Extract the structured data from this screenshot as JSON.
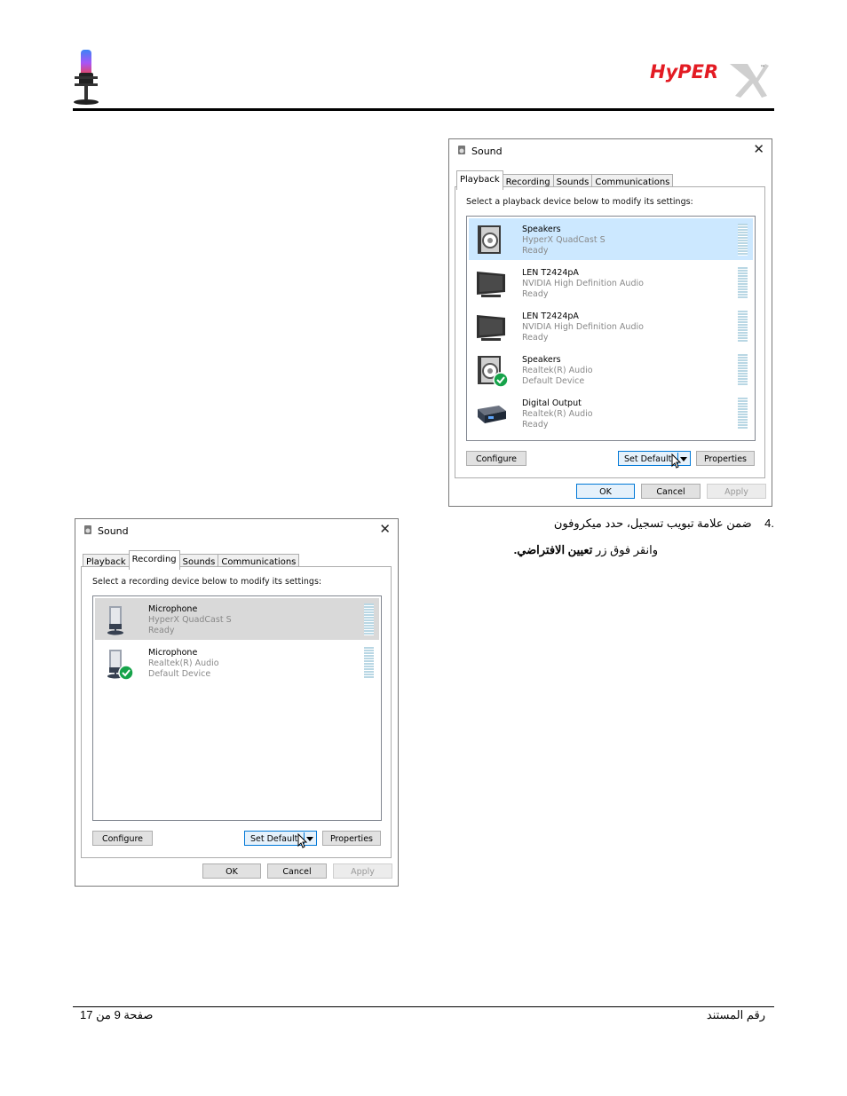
{
  "header": {
    "brand": "HyPER",
    "brand_tm": "™"
  },
  "step4": {
    "number": ".4",
    "line1": "ضمن علامة تبويب تسجيل، حدد ميكروفون",
    "line2_prefix": "وانقر فوق زر ",
    "line2_bold": "تعيين الافتراضي",
    "line2_suffix": "."
  },
  "footer": {
    "page": "صفحة 9 من 17",
    "doc_number": "رقم المستند"
  },
  "playback_dialog": {
    "title": "Sound",
    "close": "✕",
    "tabs": [
      "Playback",
      "Recording",
      "Sounds",
      "Communications"
    ],
    "active_tab": "Playback",
    "instruction": "Select a playback device below to modify its settings:",
    "devices": [
      {
        "name": "Speakers",
        "driver": "HyperX QuadCast S",
        "status": "Ready",
        "icon": "speaker-icon"
      },
      {
        "name": "LEN T2424pA",
        "driver": "NVIDIA High Definition Audio",
        "status": "Ready",
        "icon": "monitor-icon"
      },
      {
        "name": "LEN T2424pA",
        "driver": "NVIDIA High Definition Audio",
        "status": "Ready",
        "icon": "monitor-icon"
      },
      {
        "name": "Speakers",
        "driver": "Realtek(R) Audio",
        "status": "Default Device",
        "icon": "speaker-default-icon"
      },
      {
        "name": "Digital Output",
        "driver": "Realtek(R) Audio",
        "status": "Ready",
        "icon": "digital-output-icon"
      }
    ],
    "configure": "Configure",
    "set_default": "Set Default",
    "properties": "Properties",
    "ok": "OK",
    "cancel": "Cancel",
    "apply": "Apply"
  },
  "recording_dialog": {
    "title": "Sound",
    "close": "✕",
    "tabs": [
      "Playback",
      "Recording",
      "Sounds",
      "Communications"
    ],
    "active_tab": "Recording",
    "instruction": "Select a recording device below to modify its settings:",
    "devices": [
      {
        "name": "Microphone",
        "driver": "HyperX QuadCast S",
        "status": "Ready",
        "icon": "microphone-icon"
      },
      {
        "name": "Microphone",
        "driver": "Realtek(R) Audio",
        "status": "Default Device",
        "icon": "microphone-default-icon"
      }
    ],
    "configure": "Configure",
    "set_default": "Set Default",
    "properties": "Properties",
    "ok": "OK",
    "cancel": "Cancel",
    "apply": "Apply"
  },
  "colors": {
    "brand_red": "#e31b23",
    "selection_blue": "#cce8ff",
    "selection_gray": "#d9d9d9",
    "check_green": "#16a34a"
  }
}
